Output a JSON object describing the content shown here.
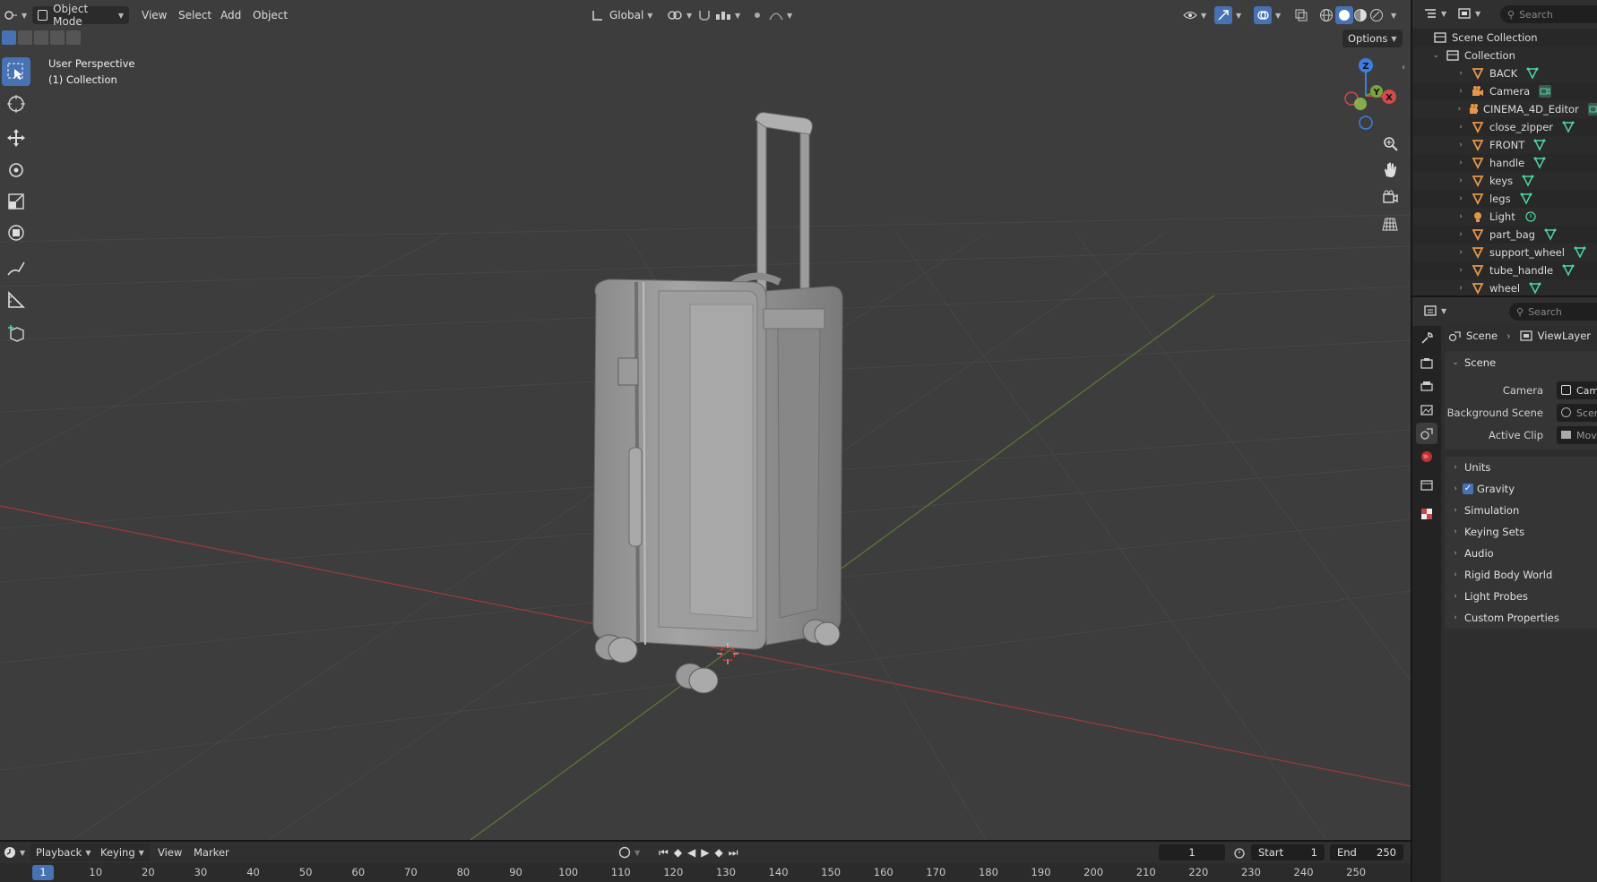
{
  "header": {
    "mode_label": "Object Mode",
    "menus": [
      "View",
      "Select",
      "Add",
      "Object"
    ],
    "transform_orientation": "Global",
    "options_label": "Options"
  },
  "viewport": {
    "view_name": "User Perspective",
    "collection_label": "(1) Collection",
    "gizmo_axes": {
      "z": "Z",
      "y": "Y",
      "x": "X"
    }
  },
  "outliner": {
    "search_placeholder": "Search",
    "scene_collection": "Scene Collection",
    "collection": "Collection",
    "items": [
      {
        "label": "BACK",
        "type": "mesh"
      },
      {
        "label": "Camera",
        "type": "camera"
      },
      {
        "label": "CINEMA_4D_Editor",
        "type": "camera"
      },
      {
        "label": "close_zipper",
        "type": "mesh"
      },
      {
        "label": "FRONT",
        "type": "mesh"
      },
      {
        "label": "handle",
        "type": "mesh"
      },
      {
        "label": "keys",
        "type": "mesh"
      },
      {
        "label": "legs",
        "type": "mesh"
      },
      {
        "label": "Light",
        "type": "light"
      },
      {
        "label": "part_bag",
        "type": "mesh"
      },
      {
        "label": "support_wheel",
        "type": "mesh"
      },
      {
        "label": "tube_handle",
        "type": "mesh"
      },
      {
        "label": "wheel",
        "type": "mesh"
      }
    ]
  },
  "properties": {
    "search_placeholder": "Search",
    "breadcrumb": [
      "Scene",
      "ViewLayer"
    ],
    "scene_panel": {
      "title": "Scene",
      "fields": [
        {
          "label": "Camera",
          "value": "Camera"
        },
        {
          "label": "Background Scene",
          "value": "Scene"
        },
        {
          "label": "Active Clip",
          "value": "Movie Clip"
        }
      ]
    },
    "panels": [
      {
        "label": "Units",
        "checkbox": false
      },
      {
        "label": "Gravity",
        "checkbox": true
      },
      {
        "label": "Simulation",
        "checkbox": false
      },
      {
        "label": "Keying Sets",
        "checkbox": false
      },
      {
        "label": "Audio",
        "checkbox": false
      },
      {
        "label": "Rigid Body World",
        "checkbox": false
      },
      {
        "label": "Light Probes",
        "checkbox": false
      },
      {
        "label": "Custom Properties",
        "checkbox": false
      }
    ]
  },
  "timeline": {
    "menus": [
      "Playback",
      "Keying",
      "View",
      "Marker"
    ],
    "current_frame": "1",
    "start_label": "Start",
    "start_value": "1",
    "end_label": "End",
    "end_value": "250",
    "frame_ticks": [
      "1",
      "10",
      "20",
      "30",
      "40",
      "50",
      "60",
      "70",
      "80",
      "90",
      "100",
      "110",
      "120",
      "130",
      "140",
      "150",
      "160",
      "170",
      "180",
      "190",
      "200",
      "210",
      "220",
      "230",
      "240",
      "250"
    ]
  },
  "colors": {
    "accent": "#4772b3",
    "mesh_icon": "#e6964b",
    "data_icon": "#4fd6a0",
    "x_axis": "#b44a4a",
    "y_axis": "#6a9a36",
    "z_axis": "#3d7fe0"
  }
}
